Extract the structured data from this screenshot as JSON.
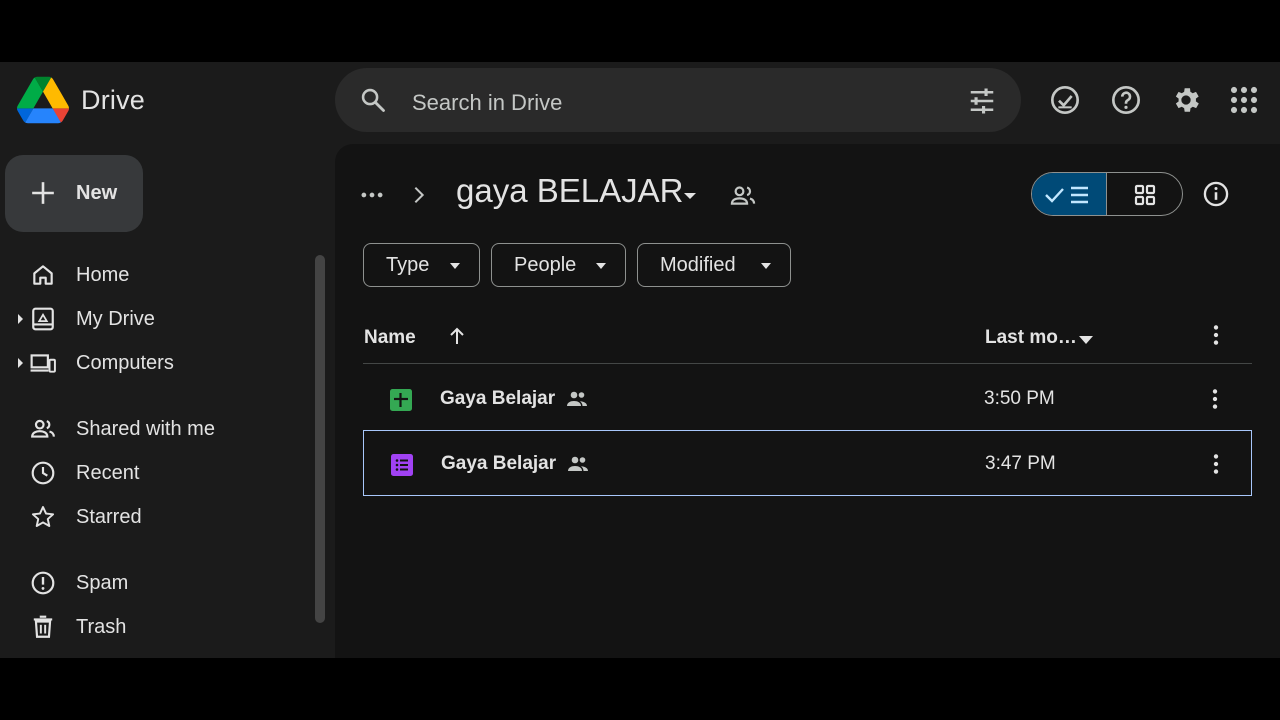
{
  "header": {
    "app_name": "Drive",
    "search_placeholder": "Search in Drive",
    "icons": [
      "search-icon",
      "tune-icon",
      "ready-for-offline-icon",
      "help-icon",
      "settings-icon",
      "apps-grid-icon"
    ]
  },
  "sidebar": {
    "new_label": "New",
    "items": [
      {
        "label": "Home",
        "icon": "home-icon"
      },
      {
        "label": "My Drive",
        "icon": "my-drive-icon",
        "expandable": true
      },
      {
        "label": "Computers",
        "icon": "computers-icon",
        "expandable": true
      },
      {
        "label": "Shared with me",
        "icon": "shared-with-me-icon"
      },
      {
        "label": "Recent",
        "icon": "recent-icon"
      },
      {
        "label": "Starred",
        "icon": "star-icon"
      },
      {
        "label": "Spam",
        "icon": "spam-icon"
      },
      {
        "label": "Trash",
        "icon": "trash-icon"
      }
    ]
  },
  "main": {
    "folder_title": "gaya BELAJAR",
    "view": "list",
    "filters": [
      {
        "label": "Type"
      },
      {
        "label": "People"
      },
      {
        "label": "Modified"
      }
    ],
    "columns": {
      "name": "Name",
      "modified": "Last mo…"
    },
    "files": [
      {
        "name": "Gaya Belajar",
        "type": "sheets",
        "shared": true,
        "modified": "3:50 PM",
        "selected": false
      },
      {
        "name": "Gaya Belajar",
        "type": "forms",
        "shared": true,
        "modified": "3:47 PM",
        "selected": true
      }
    ]
  },
  "colors": {
    "background": "#131313",
    "surface": "#1b1b1b",
    "search_bg": "#2a2a2a",
    "new_button_bg": "#37393b",
    "view_toggle_active": "#004a77",
    "sheets_green": "#34a853",
    "forms_purple": "#a142f4",
    "selection_border": "#a8c7fa"
  }
}
